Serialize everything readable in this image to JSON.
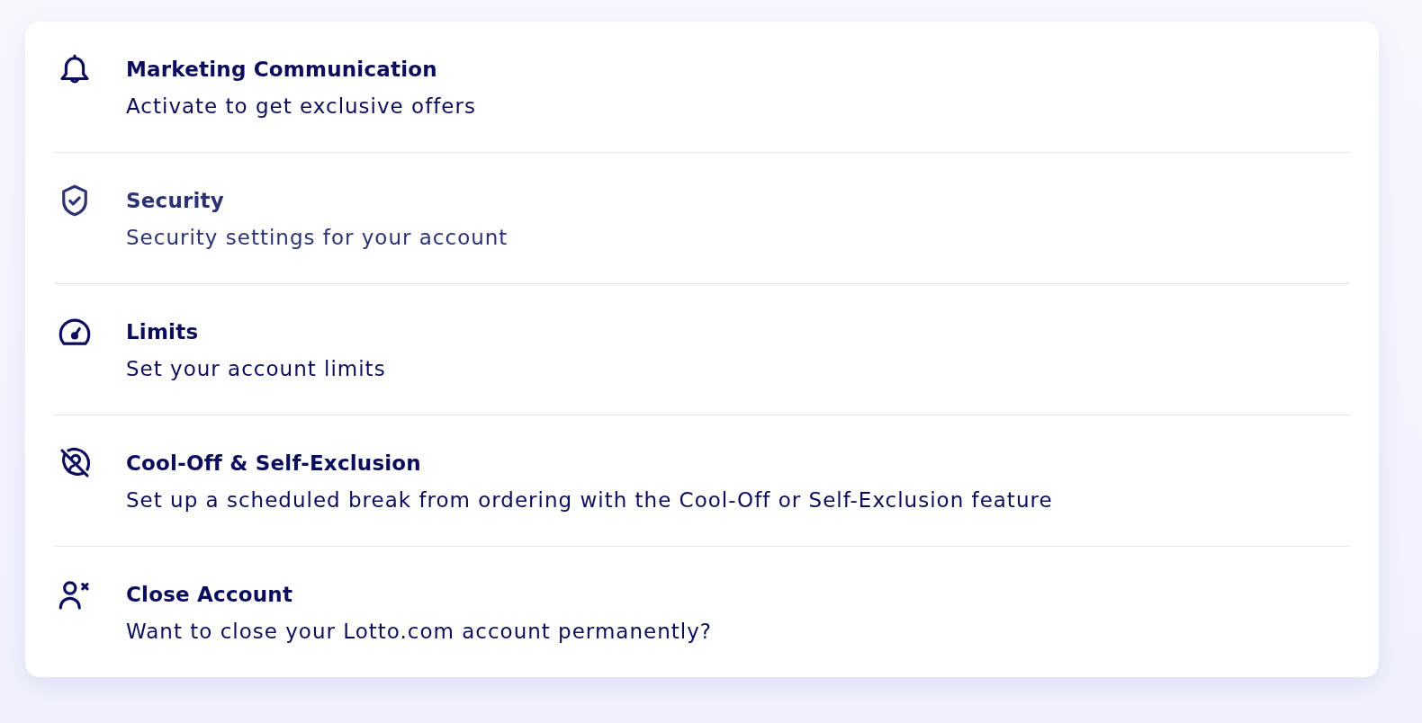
{
  "settings_menu": {
    "items": [
      {
        "title": "Marketing Communication",
        "description": "Activate to get exclusive offers",
        "hovered": false
      },
      {
        "title": "Security",
        "description": "Security settings for your account",
        "hovered": true
      },
      {
        "title": "Limits",
        "description": "Set your account limits",
        "hovered": false
      },
      {
        "title": "Cool-Off & Self-Exclusion",
        "description": "Set up a scheduled break from ordering with the Cool-Off or Self-Exclusion feature",
        "hovered": false
      },
      {
        "title": "Close Account",
        "description": "Want to close your Lotto.com account permanently?",
        "hovered": false
      }
    ]
  }
}
